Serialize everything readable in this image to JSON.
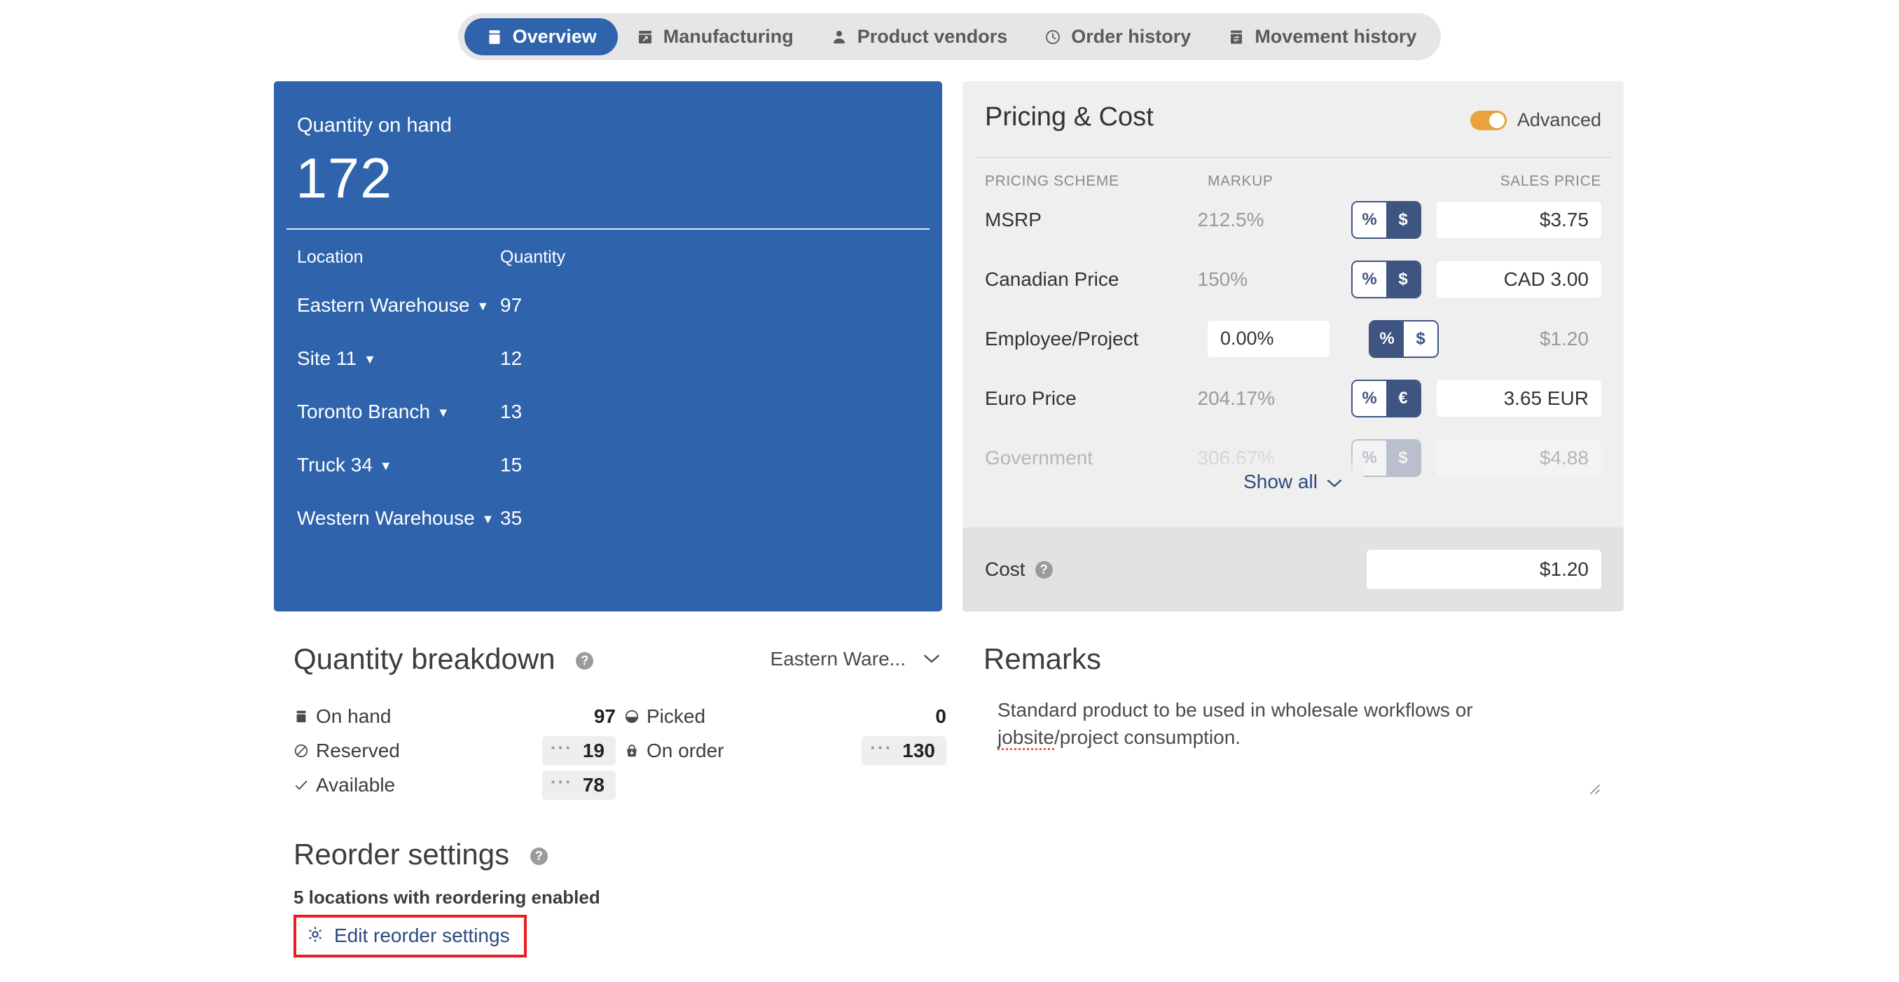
{
  "tabs": [
    {
      "label": "Overview",
      "icon": "box-icon",
      "active": true
    },
    {
      "label": "Manufacturing",
      "icon": "factory-icon",
      "active": false
    },
    {
      "label": "Product vendors",
      "icon": "person-icon",
      "active": false
    },
    {
      "label": "Order history",
      "icon": "clock-icon",
      "active": false
    },
    {
      "label": "Movement history",
      "icon": "archive-swap-icon",
      "active": false
    }
  ],
  "quantity_on_hand": {
    "title": "Quantity on hand",
    "value": "172",
    "columns": {
      "location": "Location",
      "quantity": "Quantity"
    },
    "rows": [
      {
        "location": "Eastern Warehouse",
        "quantity": "97"
      },
      {
        "location": "Site 11",
        "quantity": "12"
      },
      {
        "location": "Toronto Branch",
        "quantity": "13"
      },
      {
        "location": "Truck 34",
        "quantity": "15"
      },
      {
        "location": "Western Warehouse",
        "quantity": "35"
      }
    ]
  },
  "pricing": {
    "title": "Pricing & Cost",
    "advanced_label": "Advanced",
    "advanced_on": true,
    "columns": {
      "scheme": "PRICING SCHEME",
      "markup": "MARKUP",
      "sales_price": "SALES PRICE"
    },
    "rows": [
      {
        "scheme": "MSRP",
        "markup": "212.5%",
        "markup_editable": false,
        "unit_left": "%",
        "unit_right": "$",
        "unit_selected": "right",
        "price": "$3.75",
        "price_editable": true,
        "faded": false
      },
      {
        "scheme": "Canadian Price",
        "markup": "150%",
        "markup_editable": false,
        "unit_left": "%",
        "unit_right": "$",
        "unit_selected": "right",
        "price": "CAD 3.00",
        "price_editable": true,
        "faded": false
      },
      {
        "scheme": "Employee/Project",
        "markup": "0.00%",
        "markup_editable": true,
        "unit_left": "%",
        "unit_right": "$",
        "unit_selected": "left",
        "price": "$1.20",
        "price_editable": false,
        "faded": false
      },
      {
        "scheme": "Euro Price",
        "markup": "204.17%",
        "markup_editable": false,
        "unit_left": "%",
        "unit_right": "€",
        "unit_selected": "right",
        "price": "3.65 EUR",
        "price_editable": true,
        "faded": false
      },
      {
        "scheme": "Government",
        "markup": "306.67%",
        "markup_editable": false,
        "unit_left": "%",
        "unit_right": "$",
        "unit_selected": "right",
        "price": "$4.88",
        "price_editable": true,
        "faded": true
      }
    ],
    "show_all_label": "Show all",
    "cost_label": "Cost",
    "cost_value": "$1.20"
  },
  "quantity_breakdown": {
    "title": "Quantity breakdown",
    "location_selected": "Eastern Ware...",
    "items_left": [
      {
        "label": "On hand",
        "value": "97",
        "icon": "box-icon",
        "chip": false
      },
      {
        "label": "Reserved",
        "value": "19",
        "icon": "no-entry-icon",
        "chip": true
      },
      {
        "label": "Available",
        "value": "78",
        "icon": "check-icon",
        "chip": true
      }
    ],
    "items_right": [
      {
        "label": "Picked",
        "value": "0",
        "icon": "picked-icon",
        "chip": false
      },
      {
        "label": "On order",
        "value": "130",
        "icon": "on-order-icon",
        "chip": true
      }
    ],
    "overflow_dots": "···"
  },
  "reorder": {
    "title": "Reorder settings",
    "summary": "5 locations with reordering enabled",
    "edit_label": "Edit reorder settings"
  },
  "remarks": {
    "title": "Remarks",
    "text_part1": "Standard product to be used in wholesale workflows or ",
    "text_spell": "jobsite",
    "text_part2": "/project consumption."
  },
  "colors": {
    "primary_blue": "#2f63ac",
    "segment_navy": "#3e5481",
    "accent_orange": "#e8a33d",
    "link_blue": "#2b4a7e",
    "highlight_red": "#ee1b24",
    "panel_grey": "#efefef",
    "cost_band_grey": "#e2e2e2"
  }
}
